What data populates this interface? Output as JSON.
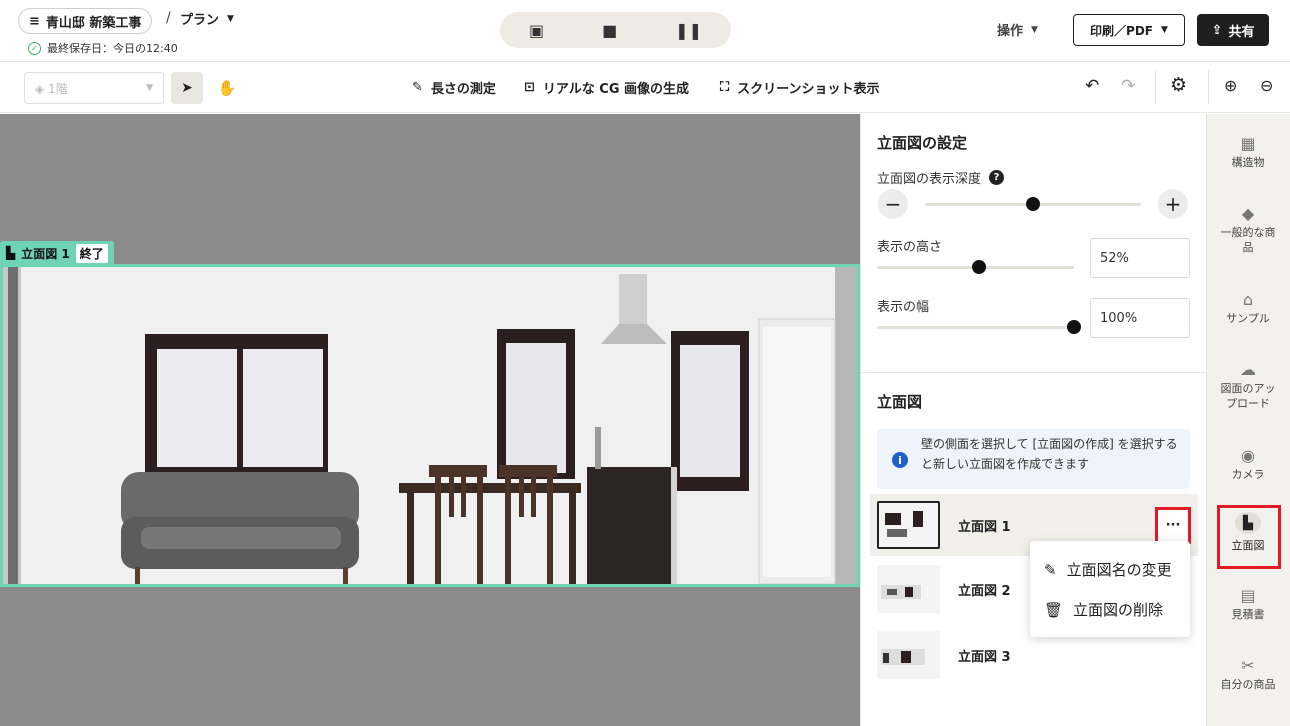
{
  "header": {
    "project_title": "青山邸 新築工事",
    "slash": "/",
    "plan_label": "プラン",
    "saved_text": "最終保存日：今日の12:40",
    "ops_label": "操作",
    "print_label": "印刷／PDF",
    "share_label": "共有"
  },
  "toolbar": {
    "floor_label": "1階",
    "measure_label": "長さの測定",
    "cg_label": "リアルな CG 画像の生成",
    "screenshot_label": "スクリーンショット表示"
  },
  "canvas": {
    "elevation_label": "立面図 1",
    "end_label": "終了"
  },
  "settings": {
    "title": "立面図の設定",
    "depth_label": "立面図の表示深度",
    "depth_level": 0.5,
    "height_label": "表示の高さ",
    "height_value": "52%",
    "height_level": 0.52,
    "width_label": "表示の幅",
    "width_value": "100%",
    "width_level": 1.0
  },
  "elevations": {
    "title": "立面図",
    "info": "壁の側面を選択して [立面図の作成] を選択すると新しい立面図を作成できます",
    "items": [
      "立面図 1",
      "立面図 2",
      "立面図 3"
    ],
    "more_label": "···",
    "menu": {
      "rename": "立面図名の変更",
      "delete": "立面図の削除"
    }
  },
  "rail": {
    "items": [
      "構造物",
      "一般的な商品",
      "サンプル",
      "図面のアップロード",
      "カメラ",
      "立面図",
      "見積書",
      "自分の商品"
    ]
  },
  "colors": {
    "accent_teal": "#6fd3b6",
    "highlight_red": "#e21b23",
    "info_blue": "#1d5fcb"
  }
}
